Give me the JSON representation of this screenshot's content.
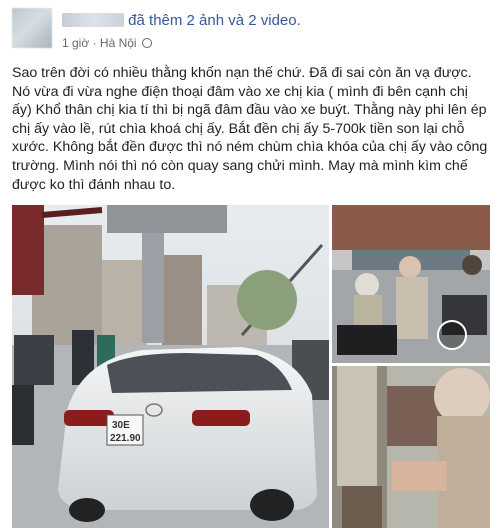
{
  "post": {
    "author_visible": "",
    "action_text": "đã thêm 2 ảnh và 2 video.",
    "time": "1 giờ",
    "separator": "·",
    "location": "Hà Nội",
    "body": "Sao trên đời có nhiều thằng khốn nạn thế chứ. Đã đi sai còn ăn vạ được. Nó vừa đi vừa nghe điện thoại đâm vào xe chị kia ( mình đi bên cạnh chị ấy) Khổ thân chị kia tí thì bị ngã đâm đầu vào xe buýt. Thằng này phi lên ép chị ấy vào lề, rút chìa khoá chị ấy. Bắt đền chị ấy 5-700k tiền son lại chỗ xước. Không bắt đền được thì nó ném chùm chìa khóa của chị ấy vào công trường. Mình nói thì nó còn quay sang chửi mình. May mà mình kìm chế được ko thì đánh nhau to."
  },
  "photos": {
    "main": {
      "plate_line1": "30E",
      "plate_line2": "221.90",
      "brand_badge": "mazda-logo"
    },
    "second": {
      "type": "video-thumbnail"
    },
    "third": {
      "type": "video-thumbnail"
    }
  },
  "colors": {
    "link": "#365899",
    "meta": "#616770",
    "text": "#1d2129",
    "car": "#eceeef"
  }
}
